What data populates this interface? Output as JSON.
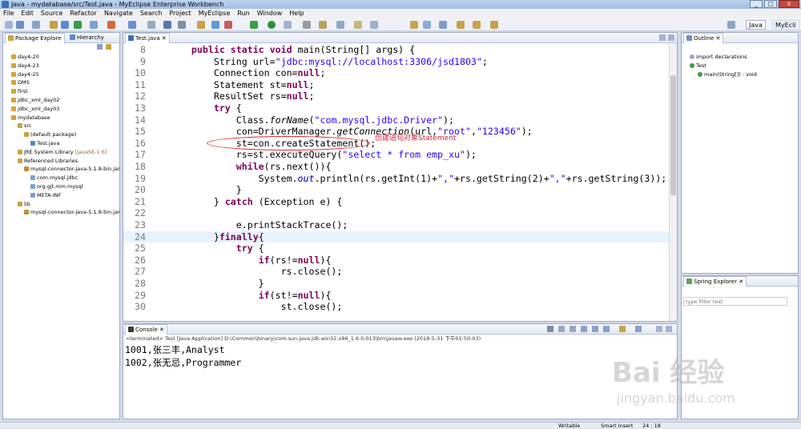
{
  "window": {
    "title": "Java - mydatabase/src/Test.java - MyEclipse Enterprise Workbench",
    "buttons": [
      "_",
      "□",
      "X"
    ]
  },
  "menu": [
    "File",
    "Edit",
    "Source",
    "Refactor",
    "Navigate",
    "Search",
    "Project",
    "MyEclipse",
    "Run",
    "Window",
    "Help"
  ],
  "perspectives": {
    "java": "Java",
    "myeclipse": "MyEcli"
  },
  "left_panel": {
    "tabs": [
      "Package Explore",
      "Hierarchy"
    ],
    "tree": [
      {
        "label": "day4-20",
        "depth": 0
      },
      {
        "label": "day4-23",
        "depth": 0
      },
      {
        "label": "day4-25",
        "depth": 0
      },
      {
        "label": "DMS",
        "depth": 0
      },
      {
        "label": "first",
        "depth": 0
      },
      {
        "label": "jdbc_xml_day02",
        "depth": 0
      },
      {
        "label": "jdbc_xml_day03",
        "depth": 0
      },
      {
        "label": "mydatabase",
        "depth": 0
      },
      {
        "label": "src",
        "depth": 1
      },
      {
        "label": "(default package)",
        "depth": 2
      },
      {
        "label": "Test.java",
        "depth": 3
      },
      {
        "label": "JRE System Library",
        "suffix": "[JavaSE-1.6]",
        "depth": 1
      },
      {
        "label": "Referenced Libraries",
        "depth": 1
      },
      {
        "label": "mysql-connector-java-5.1.8-bin.jar",
        "depth": 2
      },
      {
        "label": "com.mysql.jdbc",
        "depth": 3
      },
      {
        "label": "org.gjt.mm.mysql",
        "depth": 3
      },
      {
        "label": "META-INF",
        "depth": 3
      },
      {
        "label": "lib",
        "depth": 1
      },
      {
        "label": "mysql-connector-java-5.1.8-bin.jar",
        "depth": 2
      }
    ]
  },
  "editor": {
    "tab": "Test.java",
    "annotation": "创建语句对象Statement",
    "lines": [
      {
        "n": "8",
        "html": "    <span class='kw'>public static void</span> main(String[] args) {"
      },
      {
        "n": "9",
        "html": "        String url=<span class='str'>\"jdbc:mysql://localhost:3306/jsd1803\"</span>;"
      },
      {
        "n": "10",
        "html": "        Connection con=<span class='kw'>null</span>;"
      },
      {
        "n": "11",
        "html": "        Statement st=<span class='kw'>null</span>;"
      },
      {
        "n": "12",
        "html": "        ResultSet rs=<span class='kw'>null</span>;"
      },
      {
        "n": "13",
        "html": "        <span class='kw'>try</span> {"
      },
      {
        "n": "14",
        "html": "            Class.<span class='sm'>forName</span>(<span class='str'>\"com.mysql.jdbc.Driver\"</span>);"
      },
      {
        "n": "15",
        "html": "            con=DriverManager.<span class='sm'>getConnection</span>(url,<span class='str'>\"root\"</span>,<span class='str'>\"123456\"</span>);"
      },
      {
        "n": "16",
        "html": "            st=con.createStatement();"
      },
      {
        "n": "17",
        "html": "            rs=st.executeQuery(<span class='str'>\"select * from emp_xu\"</span>);"
      },
      {
        "n": "18",
        "html": "            <span class='kw'>while</span>(rs.next()){"
      },
      {
        "n": "19",
        "html": "                System.<span class='sm' style='color:#0000c0'>out</span>.println(rs.getInt(1)+<span class='str'>\",\"</span>+rs.getString(2)+<span class='str'>\",\"</span>+rs.getString(3));"
      },
      {
        "n": "20",
        "html": "            }"
      },
      {
        "n": "21",
        "html": "        } <span class='kw'>catch</span> (Exception e) {"
      },
      {
        "n": "22",
        "html": ""
      },
      {
        "n": "23",
        "html": "            e.printStackTrace();"
      },
      {
        "n": "24",
        "html": "        }<span class='kw'>finally</span>{"
      },
      {
        "n": "25",
        "html": "            <span class='kw'>try</span> {"
      },
      {
        "n": "26",
        "html": "                <span class='kw'>if</span>(rs!=<span class='kw'>null</span>){"
      },
      {
        "n": "27",
        "html": "                    rs.close();"
      },
      {
        "n": "28",
        "html": "                }"
      },
      {
        "n": "29",
        "html": "                <span class='kw'>if</span>(st!=<span class='kw'>null</span>){"
      },
      {
        "n": "30",
        "html": "                    st.close();"
      }
    ]
  },
  "outline": {
    "tab": "Outline",
    "items": [
      {
        "label": "import declarations",
        "depth": 0
      },
      {
        "label": "Test",
        "depth": 0
      },
      {
        "label": "main(String[]) : void",
        "depth": 1
      }
    ]
  },
  "spring": {
    "tab": "Spring Explorer",
    "filter_placeholder": "type filter text"
  },
  "console": {
    "tab": "Console",
    "header": "<terminated> Test [Java Application] D:\\Common\\binary\\com.sun.java.jdk.win32.x86_1.6.0.013\\bin\\javaw.exe (2018-5-31 下午01:50:03)",
    "output": [
      "1001,张三丰,Analyst",
      "1002,张无忌,Programmer"
    ]
  },
  "statusbar": {
    "writable": "Writable",
    "insert_mode": "Smart Insert",
    "position": "24 : 18"
  },
  "watermark": {
    "logo": "Bai 经验",
    "url": "jingyan.baidu.com"
  }
}
